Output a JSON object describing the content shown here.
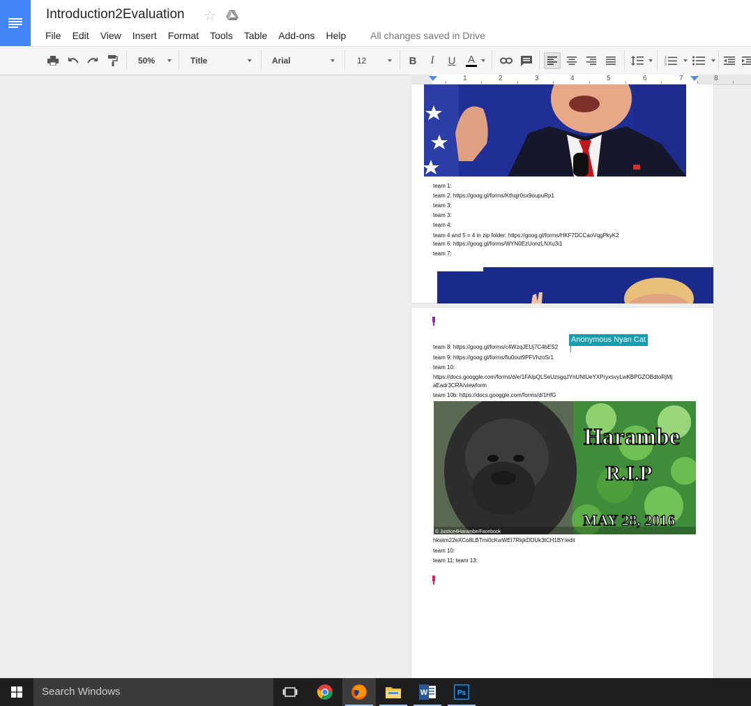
{
  "header": {
    "doc_title": "Introduction2Evaluation",
    "menu": [
      "File",
      "Edit",
      "View",
      "Insert",
      "Format",
      "Tools",
      "Table",
      "Add-ons",
      "Help"
    ],
    "save_status": "All changes saved in Drive"
  },
  "toolbar": {
    "zoom": "50%",
    "style": "Title",
    "font": "Arial",
    "font_size": "12",
    "bold_label": "B",
    "italic_label": "I",
    "underline_label": "U",
    "text_color_label": "A"
  },
  "ruler": {
    "numbers": [
      "1",
      "2",
      "3",
      "4",
      "5",
      "6",
      "7",
      "8"
    ]
  },
  "page1": {
    "lines": [
      "team 1:",
      "team 2: https://goog.gl/forms/Kthqjr0sx9oupuRp1",
      "team 3:",
      "team 3:",
      "team 4:",
      "team  4 and 5 = 4 in zip folder: https://goog.gl/forms/HKF7DCCaoVqgPkyK2",
      "team  6: https://goog.gl/forms/WYN0EzUonzLNXu3i1",
      "team  7:"
    ]
  },
  "page2": {
    "collaborator_name": "Anonymous Nyan Cat",
    "lines_top": [
      "team  8: https://goog.gl/forms/c4WzqJEUj7C4bES2",
      "team  9: https://goog.gl/forms/fiu0out9PFVhzoSr1",
      "team  10:",
      "https://docs.googgle.com/forms/d/e/1FAIpQLSeUzsgqJYnUNtUeYXPryxsvyLwKBPGZOBdtoRjMj",
      "aEadr3CRA/viewform",
      "team  10b: https://docs.googgle.com/forms/d/1HfG"
    ],
    "image_text": {
      "name": "Harambe",
      "rip": "R.I.P",
      "date": "MAY 28, 2016",
      "credit": "© Justice4Harambe/Facebook"
    },
    "lines_bottom": [
      "hkwim22eXCo8LBTmi0cKwWEI7RkjkDDUk3tCH1BY/edit",
      "team  10:",
      "team  11: team  13:"
    ]
  },
  "taskbar": {
    "search_placeholder": "Search Windows"
  },
  "colors": {
    "docs_blue": "#4285f4",
    "collaborator": "#159db0",
    "cursor_purple": "#9c27b0",
    "cursor_pink": "#e91e63"
  }
}
